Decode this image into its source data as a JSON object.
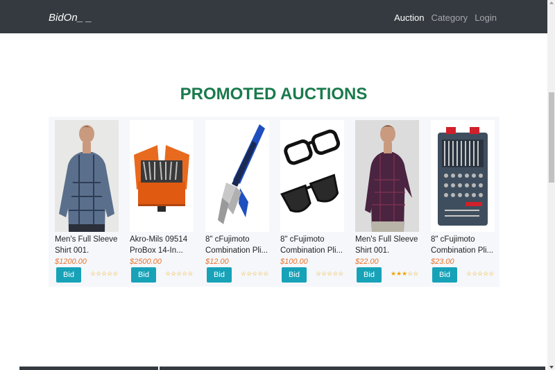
{
  "navbar": {
    "brand": "BidOn_ _",
    "links": [
      {
        "label": "Auction",
        "active": true
      },
      {
        "label": "Category",
        "active": false
      },
      {
        "label": "Login",
        "active": false
      }
    ]
  },
  "section_title": "PROMOTED AUCTIONS",
  "products": [
    {
      "name": "Men's Full Sleeve Shirt 001.",
      "price": "$1200.00",
      "button": "Bid Now",
      "rating": 0,
      "image": "blue-plaid-shirt"
    },
    {
      "name": "Akro-Mils 09514 ProBox 14-In...",
      "price": "$2500.00",
      "button": "Bid Now",
      "rating": 0,
      "image": "orange-toolbox"
    },
    {
      "name": "8\" cFujimoto Combination Pli...",
      "price": "$12.00",
      "button": "Bid Now",
      "rating": 0,
      "image": "blue-pliers"
    },
    {
      "name": "8\" cFujimoto Combination Pli...",
      "price": "$100.00",
      "button": "Bid Now",
      "rating": 0,
      "image": "sunglasses"
    },
    {
      "name": "Men's Full Sleeve Shirt 001.",
      "price": "$22.00",
      "button": "Bid Now",
      "rating": 3,
      "image": "maroon-check-shirt"
    },
    {
      "name": "8\" cFujimoto Combination Pli...",
      "price": "$23.00",
      "button": "Bid Now",
      "rating": 0,
      "image": "tool-set-case"
    }
  ],
  "colors": {
    "navbar": "#343a40",
    "title": "#1a7a4c",
    "price": "#e8732b",
    "button": "#17a2b8",
    "star": "#f0a500"
  }
}
